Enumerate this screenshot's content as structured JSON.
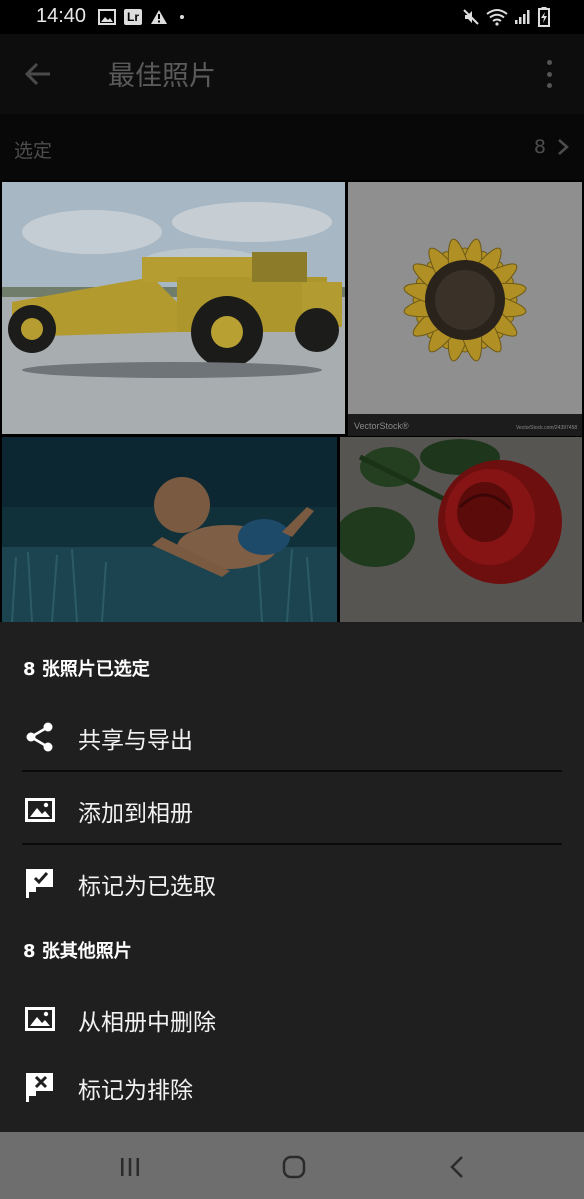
{
  "status_bar": {
    "time": "14:40",
    "app_badge": "Lr",
    "left_icons": [
      "gallery-icon",
      "lightroom-icon",
      "warning-icon",
      "dot-icon"
    ],
    "right_icons": [
      "mute-icon",
      "wifi-icon",
      "signal-icon",
      "battery-charging-icon"
    ]
  },
  "app_bar": {
    "title": "最佳照片",
    "back_icon": "arrow-back-icon",
    "menu_icon": "more-vert-icon"
  },
  "selection_row": {
    "label": "选定",
    "count": "8",
    "chevron_icon": "chevron-right-icon"
  },
  "photos": [
    {
      "name": "yellow-scraper-truck"
    },
    {
      "name": "sunflower-drawing",
      "watermark": "VectorStock®",
      "watermark_url": "VectorStock.com/24397458"
    },
    {
      "name": "baby-swimming-underwater"
    },
    {
      "name": "red-rose"
    }
  ],
  "sheet": {
    "selected_header": "8 张照片已选定",
    "selected_actions": [
      {
        "label": "共享与导出",
        "icon": "share-icon"
      },
      {
        "label": "添加到相册",
        "icon": "add-to-album-icon"
      },
      {
        "label": "标记为已选取",
        "icon": "flag-pick-icon"
      }
    ],
    "other_header": "8 张其他照片",
    "other_actions": [
      {
        "label": "从相册中删除",
        "icon": "remove-from-album-icon"
      },
      {
        "label": "标记为排除",
        "icon": "flag-reject-icon"
      }
    ]
  },
  "nav_bar": {
    "buttons": [
      "recents-icon",
      "home-icon",
      "back-icon"
    ]
  },
  "colors": {
    "sheet_bg": "#1f1f1f",
    "scrim_bg": "#000000",
    "nav_bg": "#6e6e6e",
    "text_primary": "#ffffff"
  }
}
